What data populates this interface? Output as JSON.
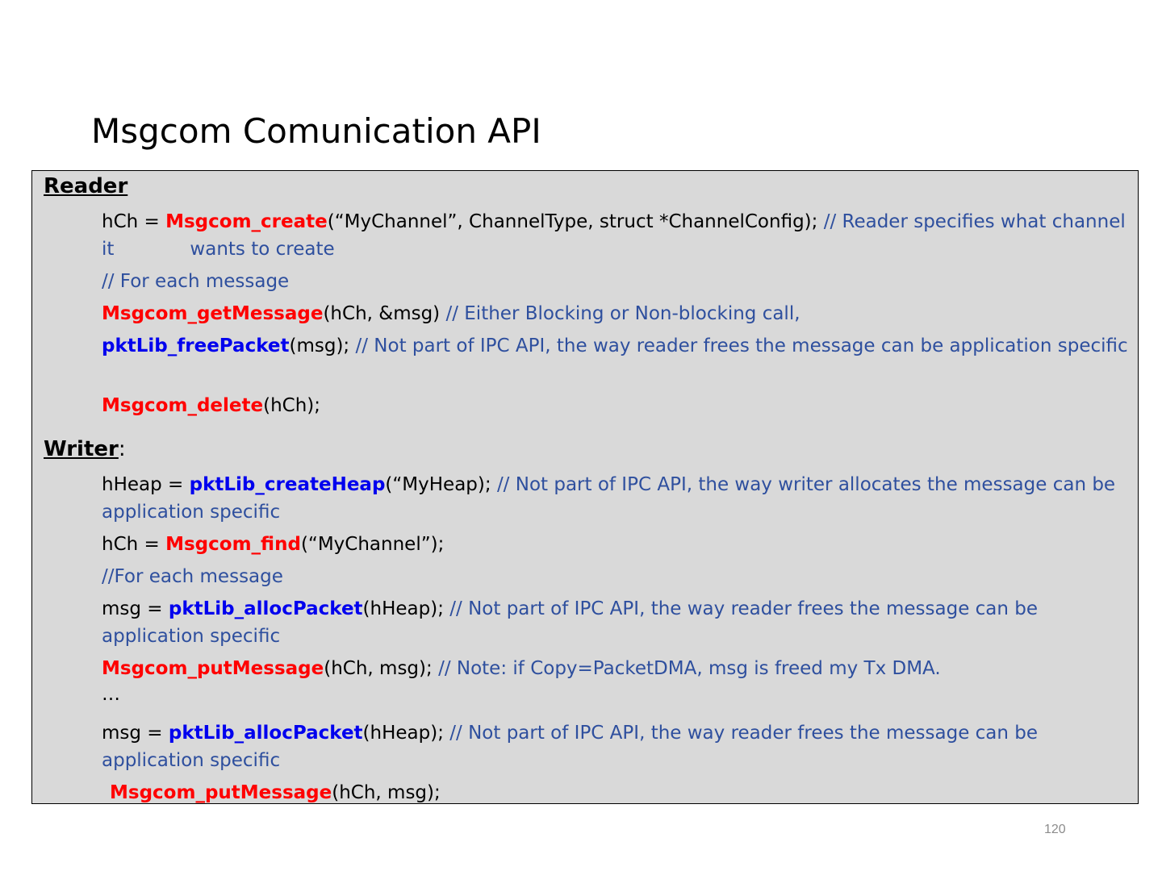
{
  "slide": {
    "title": "Msgcom Comunication API",
    "page_number": "120"
  },
  "reader": {
    "heading": "Reader",
    "l1_pre": "hCh = ",
    "l1_fn": "Msgcom_create",
    "l1_args": "(“MyChannel”, ChannelType, struct *ChannelConfig); ",
    "l1_comment_a": "// Reader specifies what channel it",
    "l1_comment_b": "wants to create",
    "l2_comment": "// For each message",
    "l3_fn": "Msgcom_getMessage",
    "l3_args": "(hCh, &msg) ",
    "l3_comment": "// Either Blocking or Non-blocking call,",
    "l4_fn": "pktLib_freePacket",
    "l4_args": "(msg); ",
    "l4_comment": "// Not part of IPC API, the way reader frees the message can be application specific",
    "l5_fn": "Msgcom_delete",
    "l5_args": "(hCh);"
  },
  "writer": {
    "heading": "Writer",
    "colon": ":",
    "l1_pre": "hHeap = ",
    "l1_fn": "pktLib_createHeap",
    "l1_args": "(“MyHeap); ",
    "l1_comment": "// Not part of IPC API, the way  writer allocates the message can be application specific",
    "l2_pre": "hCh = ",
    "l2_fn": "Msgcom_find",
    "l2_args": "(“MyChannel”);",
    "l3_comment": "//For each message",
    "l4_pre": "msg = ",
    "l4_fn": "pktLib_allocPacket",
    "l4_args": "(hHeap); ",
    "l4_comment": "// Not part of IPC API, the way reader frees the message can be application specific",
    "l5_fn": "Msgcom_putMessage",
    "l5_args": "(hCh, msg); ",
    "l5_comment": "// Note: if Copy=PacketDMA, msg is freed my Tx DMA.",
    "l6_ellipsis": "…",
    "l7_pre": "msg = ",
    "l7_fn": "pktLib_allocPacket",
    "l7_args": "(hHeap); ",
    "l7_comment": "// Not part of IPC API, the way reader frees the message can be application specific",
    "l8_fn": "Msgcom_putMessage",
    "l8_args": "(hCh, msg);"
  }
}
